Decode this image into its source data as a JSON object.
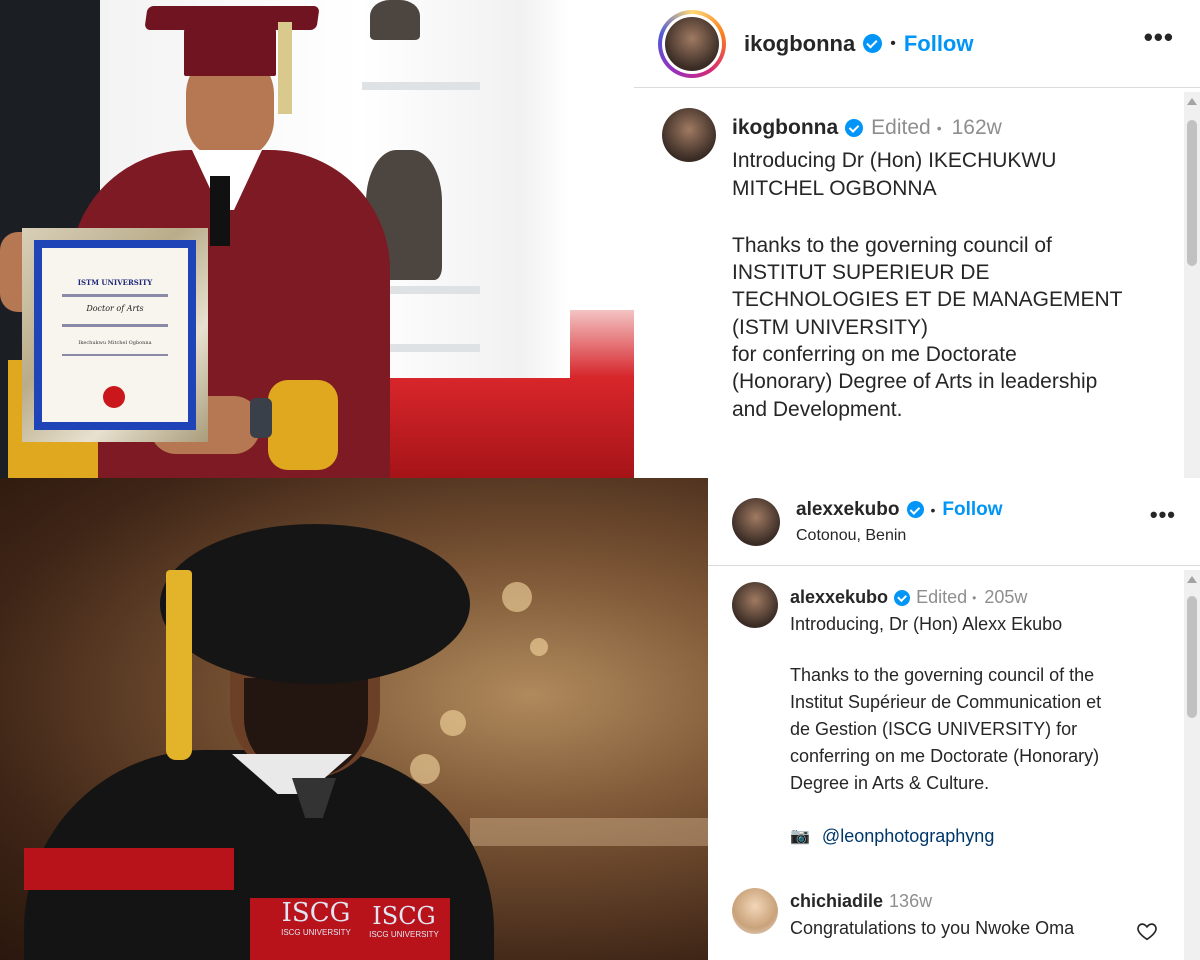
{
  "post_top": {
    "header": {
      "username": "ikogbonna",
      "separator": "•",
      "follow_label": "Follow",
      "more_icon": "•••"
    },
    "caption": {
      "username": "ikogbonna",
      "edited": "Edited",
      "separator": "•",
      "age": "162w",
      "line1": "Introducing Dr (Hon) IKECHUKWU",
      "line2": "MITCHEL OGBONNA",
      "paragraph2_lines": [
        "Thanks to the governing council of",
        "INSTITUT SUPERIEUR DE",
        "TECHNOLOGIES ET DE MANAGEMENT",
        "(ISTM UNIVERSITY)",
        "for conferring on me Doctorate",
        "(Honorary) Degree of Arts in leadership",
        "and Development."
      ]
    },
    "certificate": {
      "heading": "ISTM UNIVERSITY",
      "degree": "Doctor of Arts",
      "name": "Ikechukwu Mitchel Ogbonna"
    }
  },
  "post_bottom": {
    "header": {
      "username": "alexxekubo",
      "separator": "•",
      "follow_label": "Follow",
      "location": "Cotonou, Benin",
      "more_icon": "•••"
    },
    "caption": {
      "username": "alexxekubo",
      "edited": "Edited",
      "separator": "•",
      "age": "205w",
      "line1": "Introducing, Dr (Hon) Alexx Ekubo",
      "paragraph2_lines": [
        "Thanks to the governing council of the",
        "Institut Supérieur de Communication et",
        "de Gestion (ISCG UNIVERSITY) for",
        "conferring on me Doctorate (Honorary)",
        "Degree in Arts & Culture."
      ],
      "camera_icon": "📷",
      "mention": "@leonphotographyng"
    },
    "comment": {
      "username": "chichiadile",
      "age": "136w",
      "text": "Congratulations to you Nwoke Oma"
    },
    "gown_text_1": "ISCG",
    "gown_text_2": "ISCG",
    "gown_sub_1": "ISCG UNIVERSITY",
    "gown_sub_2": "ISCG UNIVERSITY"
  },
  "colors": {
    "accent": "#0095f6",
    "gown_maroon": "#7d1a24",
    "gown_red": "#b8121b"
  }
}
